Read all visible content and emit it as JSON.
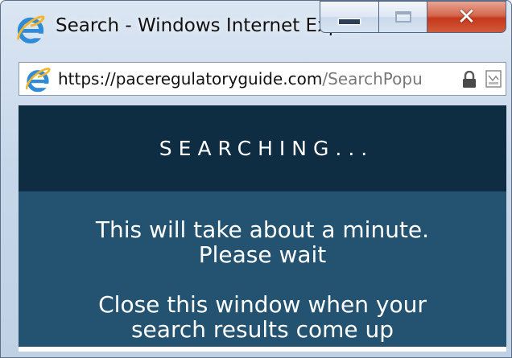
{
  "window": {
    "title": "Search - Windows Internet Expl...",
    "controls": {
      "minimize": "minimize",
      "maximize": "maximize",
      "close": "close"
    }
  },
  "address_bar": {
    "url_host": "https://paceregulatoryguide.com",
    "url_path": "/SearchPopu",
    "icons": [
      "ie-logo-icon",
      "lock-icon",
      "compatibility-view-icon"
    ]
  },
  "content": {
    "heading": "SEARCHING...",
    "line1": "This will take about a minute.",
    "line2": "Please wait",
    "line3": "Close this window when your",
    "line4": "search results come up"
  },
  "colors": {
    "header_bg": "#0f2d42",
    "body_bg": "#235370",
    "text": "#ffffff",
    "close_button": "#c6381c"
  }
}
